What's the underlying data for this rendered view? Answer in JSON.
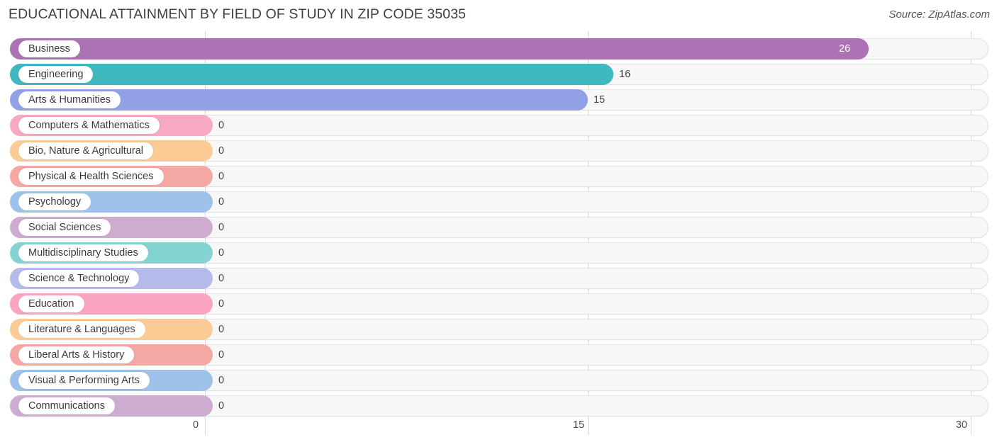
{
  "header": {
    "title": "EDUCATIONAL ATTAINMENT BY FIELD OF STUDY IN ZIP CODE 35035",
    "source": "Source: ZipAtlas.com"
  },
  "chart_data": {
    "type": "bar",
    "orientation": "horizontal",
    "title": "EDUCATIONAL ATTAINMENT BY FIELD OF STUDY IN ZIP CODE 35035",
    "subtitle": "",
    "xlabel": "",
    "ylabel": "",
    "xlim": [
      0,
      30
    ],
    "xticks": [
      0,
      15,
      30
    ],
    "xtick_labels": [
      "0",
      "15",
      "30"
    ],
    "grid": true,
    "legend": "none",
    "categories": [
      "Business",
      "Engineering",
      "Arts & Humanities",
      "Computers & Mathematics",
      "Bio, Nature & Agricultural",
      "Physical & Health Sciences",
      "Psychology",
      "Social Sciences",
      "Multidisciplinary Studies",
      "Science & Technology",
      "Education",
      "Literature & Languages",
      "Liberal Arts & History",
      "Visual & Performing Arts",
      "Communications"
    ],
    "values": [
      26,
      16,
      15,
      0,
      0,
      0,
      0,
      0,
      0,
      0,
      0,
      0,
      0,
      0,
      0
    ],
    "value_labels": [
      "26",
      "16",
      "15",
      "0",
      "0",
      "0",
      "0",
      "0",
      "0",
      "0",
      "0",
      "0",
      "0",
      "0",
      "0"
    ],
    "colors": [
      "#ac72b4",
      "#3fb8c0",
      "#92a0e6",
      "#f7a8c2",
      "#fbcb96",
      "#f4a7a3",
      "#9dc2ea",
      "#ceacd0",
      "#83d4d1",
      "#b4bbeb",
      "#fba4c2",
      "#fbcb96",
      "#f4a7a3",
      "#9dc2ea",
      "#ceacd0"
    ]
  }
}
